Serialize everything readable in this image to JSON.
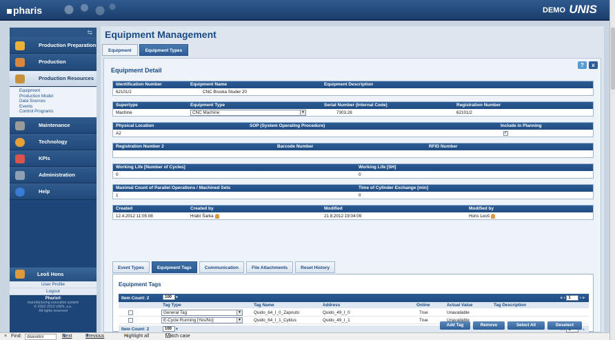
{
  "header": {
    "brand": "pharis",
    "env_label": "DEMO",
    "vendor_logo": "UNIS"
  },
  "sidebar": {
    "collapse_glyph": "⇆",
    "items": [
      {
        "label": "Production Preparation",
        "icon": "production-preparation-icon",
        "color": "#e8b23a"
      },
      {
        "label": "Production",
        "icon": "production-icon",
        "color": "#d7883c"
      },
      {
        "label": "Production Resources",
        "icon": "production-resources-icon",
        "color": "#c9913c"
      },
      {
        "label": "Maintenance",
        "icon": "maintenance-icon",
        "color": "#9a9a9a"
      },
      {
        "label": "Technology",
        "icon": "technology-icon",
        "color": "#e8a03a"
      },
      {
        "label": "KPIs",
        "icon": "kpis-icon",
        "color": "#d9534f"
      },
      {
        "label": "Administration",
        "icon": "administration-icon",
        "color": "#8f9fb4"
      },
      {
        "label": "Help",
        "icon": "help-icon",
        "color": "#3a7bd5"
      }
    ],
    "subitems": [
      "Equipment",
      "Production Model",
      "Data Sources",
      "Events",
      "Control Programs"
    ],
    "user": {
      "name": "Leoš Hons",
      "profile": "User Profile",
      "logout": "Logout"
    },
    "footer": {
      "brand": "Pharis®",
      "line1": "manufacturing execution system",
      "line2": "© 2002-2012 UNIS, a.s.",
      "line3": "All rights reserved"
    }
  },
  "main": {
    "title": "Equipment Management",
    "tabs": [
      "Equipment",
      "Equipment Types"
    ],
    "panel_title": "Equipment Detail",
    "help_btn": "?",
    "close_btn": "x",
    "row1": {
      "id_label": "Identification Number",
      "name_label": "Equipment Name",
      "desc_label": "Equipment Description",
      "id_value": "62101/2",
      "name_value": "CNC Bruska Studer 20"
    },
    "row2": {
      "supertype_label": "Supertype",
      "type_label": "Equipment Type",
      "serial_label": "Serial Number (Internal Code)",
      "reg_label": "Registration Number",
      "supertype_value": "Machine",
      "type_value": "CNC Machine",
      "serial_value": "7303.28",
      "reg_value": "62101/2"
    },
    "row3": {
      "loc_label": "Physical Location",
      "sop_label": "SOP (System Operating Procedure)",
      "plan_label": "Include in Planning",
      "loc_value": "A2",
      "plan_checked": "✓"
    },
    "row4": {
      "reg2_label": "Registration Number 2",
      "barcode_label": "Barcode Number",
      "rfid_label": "RFID Number"
    },
    "row5": {
      "life_cycles_label": "Working Life [Number of Cycles]",
      "life_sh_label": "Working Life [SH]",
      "life_cycles_value": "0",
      "life_sh_value": "0"
    },
    "row6": {
      "max_ops_label": "Maximal Count of Parallel Operations / Machined Sets",
      "cyl_label": "Time of Cylinder Exchange [min]",
      "max_ops_value": "1",
      "cyl_value": "0"
    },
    "row7": {
      "created_label": "Created",
      "created_by_label": "Created by",
      "modified_label": "Modified",
      "modified_by_label": "Modified by",
      "created_value": "12.4.2012 11:05:08",
      "created_by_value": "Hrabí Šarka",
      "modified_value": "21.8.2012 19:04:09",
      "modified_by_value": "Hons Leoš"
    },
    "subtabs": [
      "Event Types",
      "Equipment Tags",
      "Communication",
      "File Attachments",
      "Reset History"
    ],
    "tags": {
      "title": "Equipment Tags",
      "item_count": "Item Count: 2",
      "page_size": "100",
      "page_num": "1",
      "columns": [
        "Tag Type",
        "Tag Name",
        "Address",
        "Online",
        "Actual Value",
        "Tag Description"
      ],
      "rows": [
        {
          "type": "General Tag",
          "name": "Quido_64_I_0_Zapnuto",
          "address": "Quido_49_I_0",
          "online": "True",
          "value": "Unavailable",
          "desc": ""
        },
        {
          "type": "E-Cycle Running [Yes/No]",
          "name": "Quido_64_I_1_Cyklus",
          "address": "Quido_49_I_1",
          "online": "True",
          "value": "Unavailable",
          "desc": ""
        }
      ],
      "buttons": [
        "Add Tag",
        "Remove",
        "Select All",
        "Deselect"
      ]
    }
  },
  "findbar": {
    "close": "×",
    "label": "Find:",
    "value": "diskrétní výrobu",
    "next": "Next",
    "previous": "Previous",
    "highlight": "Highlight all",
    "match_case": "Match case"
  }
}
